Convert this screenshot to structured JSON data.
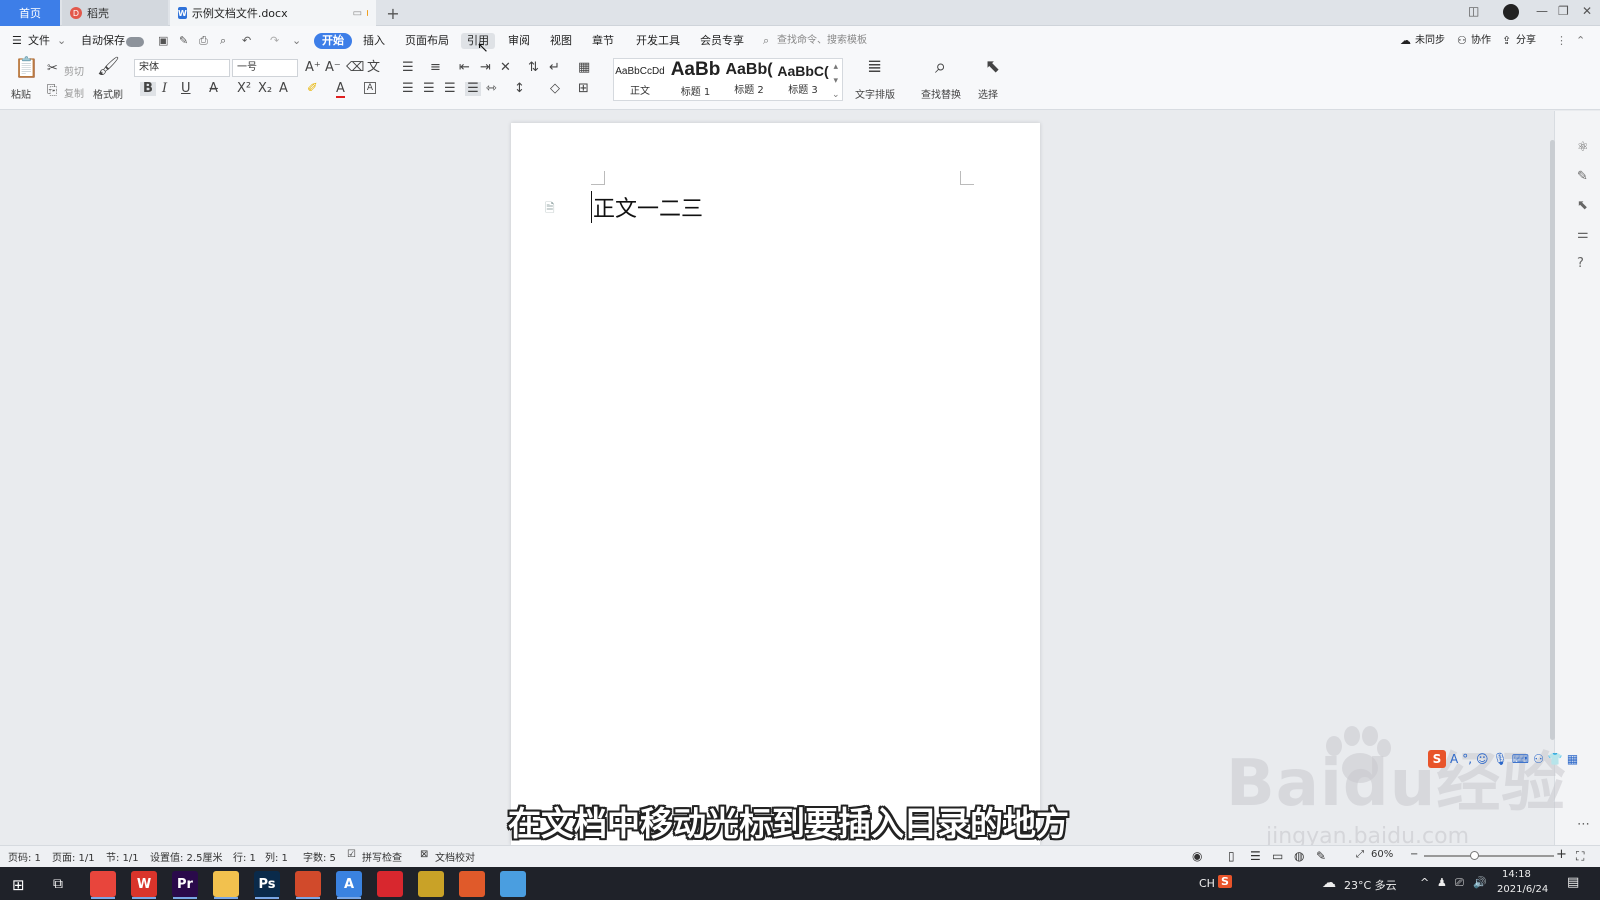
{
  "titlebar": {
    "tabs": [
      {
        "label": "首页"
      },
      {
        "label": "稻壳"
      },
      {
        "label": "示例文档文件.docx"
      }
    ],
    "new_tab": "+"
  },
  "menu": {
    "file": "文件",
    "autosave": "自动保存",
    "items": [
      "开始",
      "插入",
      "页面布局",
      "引用",
      "审阅",
      "视图",
      "章节",
      "开发工具",
      "会员专享"
    ],
    "search_placeholder": "查找命令、搜索模板",
    "right": {
      "sync": "未同步",
      "collab": "协作",
      "share": "分享"
    }
  },
  "toolbar": {
    "paste": "粘贴",
    "cut": "剪切",
    "copy": "复制",
    "format_painter": "格式刷",
    "font_name": "宋体",
    "font_size": "一号",
    "styles": [
      {
        "sample": "AaBbCcDd",
        "name": "正文"
      },
      {
        "sample": "AaBb",
        "name": "标题 1"
      },
      {
        "sample": "AaBb(",
        "name": "标题 2"
      },
      {
        "sample": "AaBbC(",
        "name": "标题 3"
      }
    ],
    "text_layout": "文字排版",
    "find_replace": "查找替换",
    "select": "选择"
  },
  "document": {
    "body_text": "正文一二三"
  },
  "statusbar": {
    "page_no": "页码: 1",
    "pages": "页面: 1/1",
    "section": "节: 1/1",
    "setting": "设置值: 2.5厘米",
    "row": "行: 1",
    "col": "列: 1",
    "word_count": "字数: 5",
    "spell_check": "拼写检查",
    "doc_proof": "文档校对",
    "zoom": "60%"
  },
  "overlay": {
    "subtitle": "在文档中移动光标到要插入目录的地方",
    "watermark": "Baidu经验",
    "watermark_url": "jingyan.baidu.com"
  },
  "taskbar": {
    "apps": [
      {
        "icon": "chrome-icon",
        "label": "",
        "color": "#e8453c"
      },
      {
        "icon": "wps-icon",
        "label": "W",
        "color": "#d9342b"
      },
      {
        "icon": "premiere-icon",
        "label": "Pr",
        "color": "#2a0a4a"
      },
      {
        "icon": "folder-icon",
        "label": "",
        "color": "#f2c14e"
      },
      {
        "icon": "photoshop-icon",
        "label": "Ps",
        "color": "#0a2a4a"
      },
      {
        "icon": "slides-icon",
        "label": "",
        "color": "#d14a2b"
      },
      {
        "icon": "app-a-icon",
        "label": "A",
        "color": "#3a82e0"
      },
      {
        "icon": "netease-music-icon",
        "label": "",
        "color": "#d8272e"
      },
      {
        "icon": "video-editor-icon",
        "label": "",
        "color": "#c9a227"
      },
      {
        "icon": "wps-office-icon",
        "label": "",
        "color": "#e05a2a"
      },
      {
        "icon": "browser-icon",
        "label": "",
        "color": "#4a9ee0"
      }
    ],
    "ime": "CH",
    "weather": "23°C 多云",
    "time": "14:18",
    "date": "2021/6/24"
  }
}
